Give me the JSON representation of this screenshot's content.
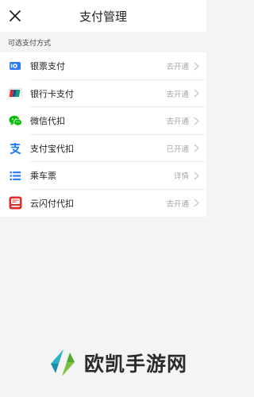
{
  "header": {
    "title": "支付管理",
    "close_icon": "close-icon"
  },
  "section": {
    "label": "可选支付方式"
  },
  "methods": [
    {
      "label": "银票支付",
      "status": "去开通",
      "icon": "ticket-pay-icon"
    },
    {
      "label": "银行卡支付",
      "status": "去开通",
      "icon": "bank-card-icon"
    },
    {
      "label": "微信代扣",
      "status": "去开通",
      "icon": "wechat-icon"
    },
    {
      "label": "支付宝代扣",
      "status": "已开通",
      "icon": "alipay-icon"
    },
    {
      "label": "乘车票",
      "status": "详情",
      "icon": "bus-ticket-icon"
    },
    {
      "label": "云闪付代扣",
      "status": "去开通",
      "icon": "quickpass-icon"
    }
  ],
  "colors": {
    "accent_blue": "#2f7df6",
    "wechat_green": "#09bb07",
    "unionpay_red": "#e12a2a"
  },
  "watermark": {
    "text": "欧凯手游网"
  }
}
